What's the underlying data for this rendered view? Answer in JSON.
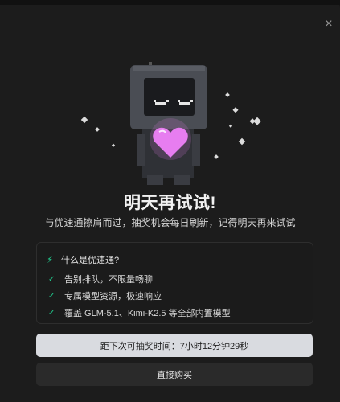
{
  "dialog": {
    "close_glyph": "×",
    "title": "明天再试试!",
    "subtitle": "与优速通擦肩而过，抽奖机会每日刷新，记得明天再来试试"
  },
  "benefits": {
    "heading": "什么是优速通?",
    "heading_icon": "bolt-icon",
    "items": [
      "告别排队，不限量畅聊",
      "专属模型资源，极速响应",
      "覆盖 GLM-5.1、Kimi-K2.5 等全部内置模型"
    ]
  },
  "actions": {
    "countdown_label": "距下次可抽奖时间：7小时12分钟29秒",
    "buy_label": "直接购买"
  },
  "colors": {
    "accent_green": "#20c58a",
    "heart_pink": "#e77df0",
    "button_light": "#d9dbe0"
  }
}
